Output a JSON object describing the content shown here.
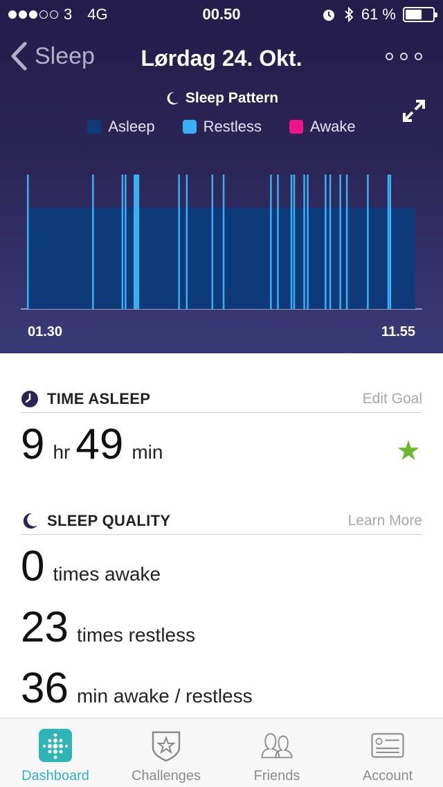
{
  "status_bar": {
    "carrier": "3",
    "network": "4G",
    "time": "00.50",
    "battery": "61 %",
    "signal_dots_filled": 3,
    "signal_dots_total": 5,
    "battery_level_fraction": 0.61
  },
  "nav": {
    "back_label": "Sleep",
    "title": "Lørdag 24. Okt.",
    "more_icon": "ellipsis-icon"
  },
  "chart_header": {
    "title": "Sleep Pattern",
    "icon": "moon-icon",
    "expand_icon": "expand-icon"
  },
  "legend": [
    {
      "label": "Asleep",
      "color": "#0f3a7a"
    },
    {
      "label": "Restless",
      "color": "#3ab0f3"
    },
    {
      "label": "Awake",
      "color": "#f0148a"
    }
  ],
  "chart_data": {
    "type": "timeline",
    "x_start": "01.30",
    "x_end": "11.55",
    "xlabel": "",
    "ylabel": "",
    "series": [
      {
        "name": "Asleep",
        "segments": [
          {
            "start": 0.0,
            "end": 1.0
          }
        ]
      },
      {
        "name": "Restless",
        "events": [
          0.0,
          0.168,
          0.244,
          0.252,
          0.277,
          0.282,
          0.39,
          0.41,
          0.476,
          0.505,
          0.627,
          0.645,
          0.68,
          0.687,
          0.713,
          0.722,
          0.768,
          0.78,
          0.806,
          0.823,
          0.877,
          0.93,
          0.935
        ]
      },
      {
        "name": "Awake",
        "events": []
      }
    ]
  },
  "time_asleep": {
    "heading": "TIME ASLEEP",
    "edit_link": "Edit Goal",
    "hours": "9",
    "hours_unit": "hr",
    "minutes": "49",
    "minutes_unit": "min",
    "goal_icon": "star-icon"
  },
  "sleep_quality": {
    "heading": "SLEEP QUALITY",
    "learn_link": "Learn More",
    "awake_count": "0",
    "awake_label": "times awake",
    "restless_count": "23",
    "restless_label": "times restless",
    "minutes": "36",
    "minutes_label": "min awake / restless"
  },
  "tabs": [
    {
      "label": "Dashboard",
      "icon": "dashboard-icon",
      "active": true
    },
    {
      "label": "Challenges",
      "icon": "challenges-icon",
      "active": false
    },
    {
      "label": "Friends",
      "icon": "friends-icon",
      "active": false
    },
    {
      "label": "Account",
      "icon": "account-icon",
      "active": false
    }
  ],
  "colors": {
    "accent": "#2fb5b5",
    "goal_star": "#6cb82d"
  }
}
